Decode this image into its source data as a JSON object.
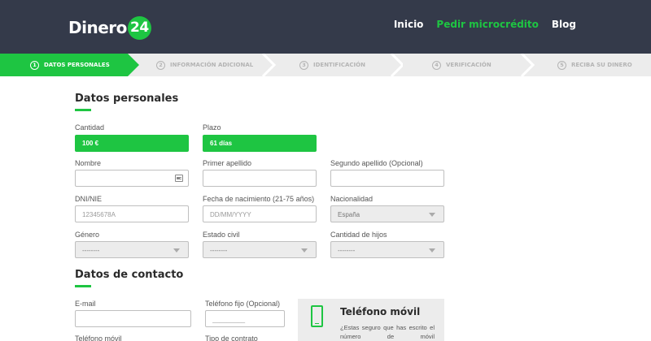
{
  "header": {
    "logo_text": "Dinero",
    "logo_badge": "24",
    "nav": [
      {
        "label": "Inicio",
        "active": false
      },
      {
        "label": "Pedir microcrédito",
        "active": true
      },
      {
        "label": "Blog",
        "active": false
      }
    ]
  },
  "steps": [
    {
      "num": "1",
      "label": "DATOS PERSONALES",
      "active": true
    },
    {
      "num": "2",
      "label": "INFORMACIÓN ADICIONAL",
      "active": false
    },
    {
      "num": "3",
      "label": "IDENTIFICACIÓN",
      "active": false
    },
    {
      "num": "4",
      "label": "VERIFICACIÓN",
      "active": false
    },
    {
      "num": "5",
      "label": "RECIBA SU DINERO",
      "active": false
    }
  ],
  "personal": {
    "title": "Datos personales",
    "cantidad": {
      "label": "Cantidad",
      "value": "100 €"
    },
    "plazo": {
      "label": "Plazo",
      "value": "61 días"
    },
    "nombre": {
      "label": "Nombre",
      "value": ""
    },
    "primer_apellido": {
      "label": "Primer apellido",
      "value": ""
    },
    "segundo_apellido": {
      "label": "Segundo apellido (Opcional)",
      "value": ""
    },
    "dni": {
      "label": "DNI/NIE",
      "placeholder": "12345678A"
    },
    "fecha": {
      "label": "Fecha de nacimiento (21-75 años)",
      "placeholder": "DD/MM/YYYY"
    },
    "nacionalidad": {
      "label": "Nacionalidad",
      "value": "España"
    },
    "genero": {
      "label": "Género",
      "value": "--------"
    },
    "estado_civil": {
      "label": "Estado civil",
      "value": "--------"
    },
    "hijos": {
      "label": "Cantidad de hijos",
      "value": "--------"
    }
  },
  "contact": {
    "title": "Datos de contacto",
    "email": {
      "label": "E-mail",
      "value": ""
    },
    "telefono_fijo": {
      "label": "Teléfono fijo (Opcional)",
      "placeholder": "_________"
    },
    "telefono_movil_label": "Teléfono móvil",
    "tipo_contrato_label": "Tipo de contrato",
    "info_box": {
      "title": "Teléfono móvil",
      "text": "¿Estas seguro que has escrito el número de móvil"
    }
  },
  "colors": {
    "accent": "#1ec542",
    "header_bg": "#343a4a",
    "steps_bg": "#ececec"
  }
}
